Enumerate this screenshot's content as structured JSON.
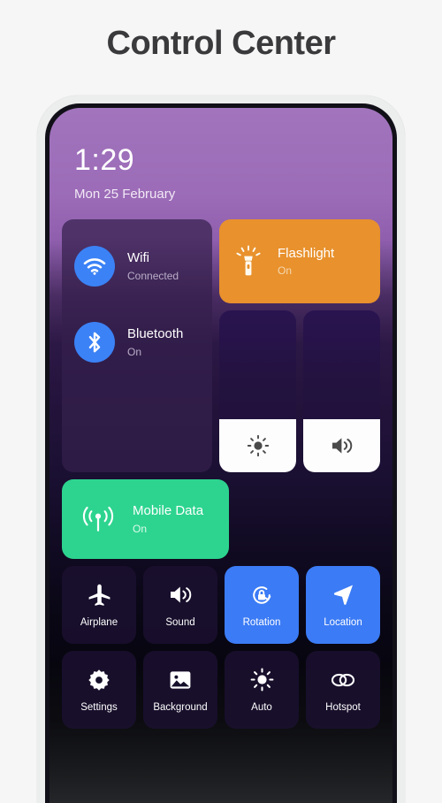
{
  "page": {
    "title": "Control Center"
  },
  "status": {
    "time": "1:29",
    "date": "Mon 25 February"
  },
  "colors": {
    "accent_blue": "#3b82f6",
    "active_blue": "#3b7bf5",
    "flashlight_orange": "#e8912d",
    "mobile_green": "#2dd48f",
    "panel_purple": "#34204c",
    "title_gray": "#3a3a3c"
  },
  "combo_panel": {
    "items": [
      {
        "icon": "wifi-icon",
        "title": "Wifi",
        "status": "Connected"
      },
      {
        "icon": "bluetooth-icon",
        "title": "Bluetooth",
        "status": "On"
      }
    ]
  },
  "flashlight": {
    "icon": "flashlight-icon",
    "title": "Flashlight",
    "status": "On"
  },
  "mobile_data": {
    "icon": "cell-signal-icon",
    "title": "Mobile Data",
    "status": "On"
  },
  "sliders": [
    {
      "name": "brightness",
      "icon": "brightness-icon",
      "level": 33
    },
    {
      "name": "volume",
      "icon": "volume-icon",
      "level": 33
    }
  ],
  "toggles": [
    {
      "icon": "airplane-icon",
      "label": "Airplane",
      "active": false
    },
    {
      "icon": "sound-icon",
      "label": "Sound",
      "active": false
    },
    {
      "icon": "rotation-lock-icon",
      "label": "Rotation",
      "active": true
    },
    {
      "icon": "location-icon",
      "label": "Location",
      "active": true
    },
    {
      "icon": "gear-icon",
      "label": "Settings",
      "active": false
    },
    {
      "icon": "image-icon",
      "label": "Background",
      "active": false
    },
    {
      "icon": "auto-brightness-icon",
      "label": "Auto",
      "active": false
    },
    {
      "icon": "hotspot-icon",
      "label": "Hotspot",
      "active": false
    }
  ]
}
